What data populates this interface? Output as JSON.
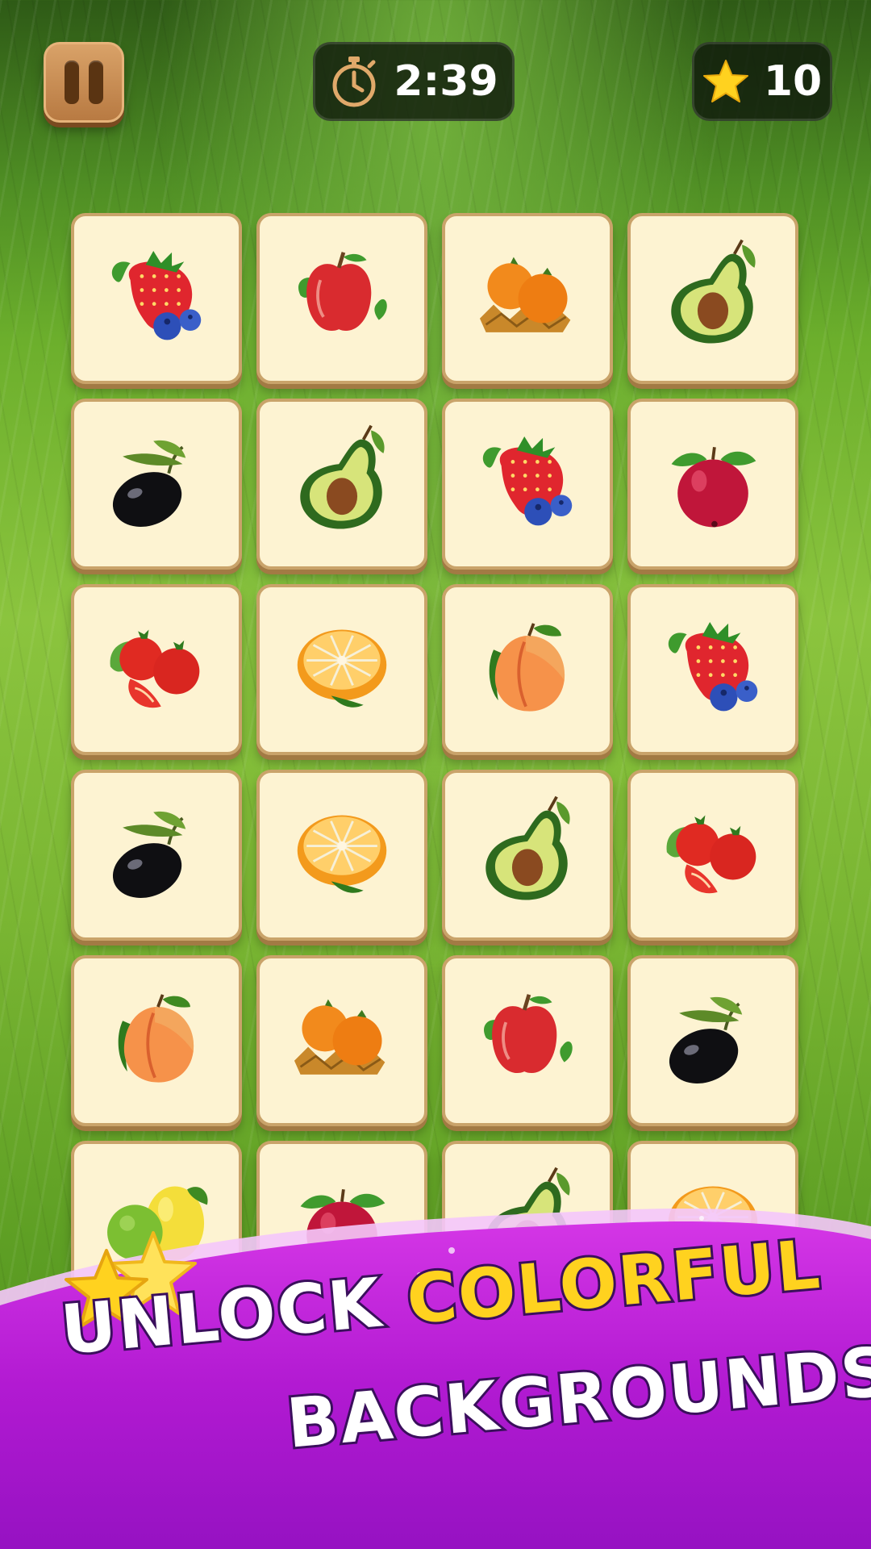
{
  "hud": {
    "timer": "2:39",
    "score": "10",
    "icons": [
      "pause-icon",
      "stopwatch-icon",
      "star-icon"
    ]
  },
  "board": {
    "rows": [
      [
        "strawberry-blueberry",
        "apple",
        "tangerine",
        "avocado"
      ],
      [
        "olive",
        "avocado",
        "strawberry-blueberry",
        "cranberry"
      ],
      [
        "tomato",
        "orange",
        "peach",
        "strawberry-blueberry"
      ],
      [
        "olive",
        "orange",
        "avocado",
        "tomato"
      ],
      [
        "peach",
        "tangerine",
        "apple",
        "olive"
      ],
      [
        "lime-lemon",
        "cranberry",
        "avocado",
        "orange"
      ]
    ]
  },
  "banner": {
    "line1_word1": "UNLOCK",
    "line1_word2": "COLORFUL",
    "line2": "BACKGROUNDS",
    "colors": {
      "purple": "#b41fd6",
      "yellow": "#ffd21f",
      "outline": "#3a0f5c"
    }
  }
}
